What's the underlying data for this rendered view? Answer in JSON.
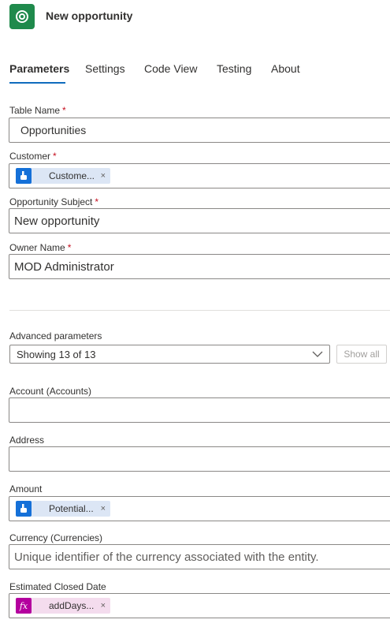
{
  "header": {
    "title": "New opportunity",
    "icon": "dataverse-logo-icon",
    "accent": "#1f8a4c"
  },
  "tabs": [
    {
      "label": "Parameters",
      "active": true
    },
    {
      "label": "Settings",
      "active": false
    },
    {
      "label": "Code View",
      "active": false
    },
    {
      "label": "Testing",
      "active": false
    },
    {
      "label": "About",
      "active": false
    }
  ],
  "required_mark": "*",
  "fields": {
    "table_name": {
      "label": "Table Name",
      "value": "Opportunities"
    },
    "customer": {
      "label": "Customer",
      "token": {
        "text": "Custome...",
        "icon": "dynamic-content-icon"
      }
    },
    "opportunity_subject": {
      "label": "Opportunity Subject",
      "value": "New opportunity"
    },
    "owner_name": {
      "label": "Owner Name",
      "value": "MOD Administrator"
    }
  },
  "advanced": {
    "label": "Advanced parameters",
    "selected": "Showing 13 of 13",
    "show_all_label": "Show all"
  },
  "advanced_fields": {
    "account": {
      "label": "Account (Accounts)",
      "value": ""
    },
    "address": {
      "label": "Address",
      "value": ""
    },
    "amount": {
      "label": "Amount",
      "token": {
        "text": "Potential...",
        "icon": "dynamic-content-icon"
      }
    },
    "currency": {
      "label": "Currency (Currencies)",
      "placeholder": "Unique identifier of the currency associated with the entity."
    },
    "estimated_closed_date": {
      "label": "Estimated Closed Date",
      "token": {
        "text": "addDays...",
        "icon": "expression-fx-icon",
        "glyph": "fx"
      }
    }
  },
  "token_remove_glyph": "×",
  "colors": {
    "tab_underline": "#0f6cbd",
    "required": "#c50f1f",
    "token_blue": "#dce6f5",
    "token_pink": "#f4dcee"
  }
}
